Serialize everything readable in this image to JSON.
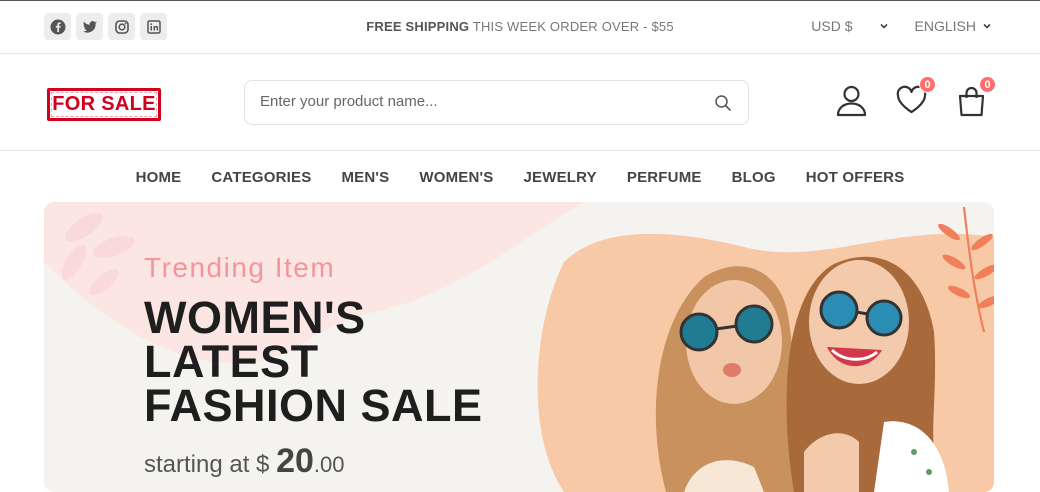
{
  "topbar": {
    "social": [
      "facebook-icon",
      "twitter-icon",
      "instagram-icon",
      "linkedin-icon"
    ],
    "promo_bold": "FREE SHIPPING",
    "promo_rest": " THIS WEEK ORDER OVER - $55",
    "currency": "USD $",
    "language": "ENGLISH"
  },
  "header": {
    "logo_text": "FOR SALE",
    "search_placeholder": "Enter your product name...",
    "wishlist_count": "0",
    "cart_count": "0"
  },
  "nav": {
    "items": [
      "HOME",
      "CATEGORIES",
      "MEN'S",
      "WOMEN'S",
      "JEWELRY",
      "PERFUME",
      "BLOG",
      "HOT OFFERS"
    ]
  },
  "hero": {
    "subtitle": "Trending Item",
    "title_line1": "WOMEN'S",
    "title_line2": "LATEST",
    "title_line3": "FASHION SALE",
    "price_prefix": "starting at $ ",
    "price_whole": "20",
    "price_cents": ".00"
  },
  "colors": {
    "accent": "#f4949d",
    "badge": "#ff6d6d",
    "logo_red": "#d1001f",
    "hero_bg": "#f4f3f0",
    "blob": "#f8c9a6"
  }
}
